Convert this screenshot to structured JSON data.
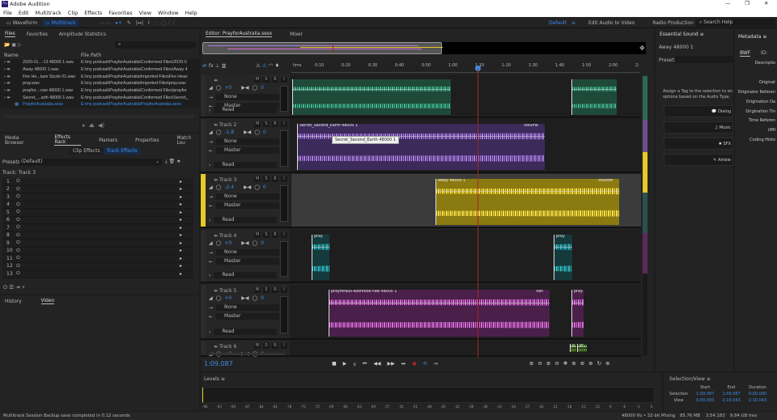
{
  "app": {
    "title": "Adobe Audition",
    "logo": "Au"
  },
  "menu": [
    "File",
    "Edit",
    "Multitrack",
    "Clip",
    "Effects",
    "Favorites",
    "View",
    "Window",
    "Help"
  ],
  "toolbar": {
    "waveform": "Waveform",
    "multitrack": "Multitrack",
    "workspaces": [
      "Default",
      "Edit Audio to Video",
      "Radio Production"
    ],
    "search_placeholder": "Search Help"
  },
  "files": {
    "tabs": [
      "Files",
      "Favorites",
      "Amplitude Statistics"
    ],
    "columns": [
      "Name",
      "File Path"
    ],
    "search_placeholder": "",
    "rows": [
      {
        "name": "2020-01...-13 48000 1.wav",
        "path": "E:\\my podcast\\PrayforAustralia\\Conformed Files\\2020-0"
      },
      {
        "name": "Away 48000 1.wav",
        "path": "E:\\my podcast\\PrayforAustralia\\Conformed Files\\Away 4"
      },
      {
        "name": "Fire He...laze Sizzle 01.wav",
        "path": "E:\\my podcast\\PrayforAustralia\\Imported Files\\Fire Heav"
      },
      {
        "name": "pray.wav",
        "path": "E:\\my podcast\\PrayforAustralia\\Imported Files\\pray.wav"
      },
      {
        "name": "prayfor...-raw 48000 1.wav",
        "path": "E:\\my podcast\\PrayforAustralia\\Conformed Files\\prayfor"
      },
      {
        "name": "Secret_...arth 48000 1.wav",
        "path": "E:\\my podcast\\PrayforAustralia\\Conformed Files\\Secret_"
      },
      {
        "name": "PrayforAustralia.sesx",
        "path": "E:\\my podcast\\PrayforAustralia\\PrayforAustralia.sesx",
        "active": true
      }
    ]
  },
  "effects": {
    "tabs": [
      "Media Browser",
      "Effects Rack",
      "Markers",
      "Properties",
      "Match Lou"
    ],
    "subtabs": [
      "Clip Effects",
      "Track Effects"
    ],
    "presets_label": "Presets:",
    "preset": "(Default)",
    "track_label": "Track: Track 3",
    "slots": [
      "1",
      "2",
      "3",
      "4",
      "5",
      "6",
      "7",
      "8",
      "9",
      "10",
      "11",
      "12",
      "13"
    ]
  },
  "bottom_tabs": [
    "History",
    "Video"
  ],
  "editor": {
    "tabs": [
      "Editor: PrayforAustralia.sesx",
      "Mixer"
    ],
    "ruler": [
      "hms",
      "0:10",
      "0:20",
      "0:30",
      "0:40",
      "0:50",
      "1:00",
      "1:10",
      "1:20",
      "1:30",
      "1:40",
      "1:50",
      "2:00",
      "2:"
    ],
    "time": "1:09.087",
    "tracks": [
      {
        "name": "",
        "vol": "+0",
        "pan": "0",
        "input": "None",
        "output": "Master",
        "mode": "Read",
        "color": "#3fb58d"
      },
      {
        "name": "Track 2",
        "vol": "-1.8",
        "pan": "0",
        "input": "None",
        "output": "Master",
        "mode": "Read",
        "color": "#a77be0"
      },
      {
        "name": "Track 3",
        "vol": "-2.4",
        "pan": "0",
        "input": "None",
        "output": "Master",
        "mode": "Read",
        "color": "#e7c928"
      },
      {
        "name": "Track 4",
        "vol": "+0",
        "pan": "0",
        "input": "None",
        "output": "Master",
        "mode": "Read",
        "color": "#2fbcc4"
      },
      {
        "name": "Track 5",
        "vol": "+0",
        "pan": "0",
        "input": "None",
        "output": "Master",
        "mode": "Read",
        "color": "#d86bd8"
      },
      {
        "name": "Track 6",
        "vol": "+0",
        "pan": "0",
        "input": "",
        "output": "",
        "mode": "",
        "color": "#8bc34a"
      }
    ],
    "clips": {
      "secret": "Secret_Second_Earth 48000 1",
      "secret_fx": "Volume",
      "tooltip": "Secret_Second_Earth 48000 1",
      "away": "Away 48000 1",
      "away_fx": "Volume",
      "pray": "pray",
      "pray_trunc": "pray...",
      "prayforaus": "prayforaus-koonfook-raw 48000 1",
      "prayforaus_fx": "Pan",
      "t6a": "p...",
      "t6b": "pr..."
    },
    "track_buttons": [
      "M",
      "S",
      "R",
      "I"
    ]
  },
  "essential": {
    "title": "Essential Sound",
    "clip": "Away 48000 1",
    "preset_label": "Preset:",
    "hint": "Assign a Tag to the selection to en options based on the Audio Type.",
    "types": [
      "Dialog",
      "Music",
      "SFX",
      "Ambie"
    ]
  },
  "metadata": {
    "title": "Metadata",
    "tabs": [
      "BWF",
      "ID:"
    ],
    "fields": [
      "Descriptio",
      "Originat",
      "Originator Referen",
      "Origination Da",
      "Origination Tin",
      "Time Referen",
      "UMI",
      "Coding Histo"
    ]
  },
  "levels": {
    "title": "Levels",
    "scale": [
      "-96",
      "-93",
      "-90",
      "-87",
      "-84",
      "-81",
      "-78",
      "-75",
      "-72",
      "-69",
      "-66",
      "-63",
      "-60",
      "-57",
      "-54",
      "-51",
      "-48",
      "-45",
      "-42",
      "-39",
      "-36",
      "-33",
      "-30",
      "-27",
      "-24",
      "-21",
      "-18",
      "-15",
      "-12",
      "-9",
      "-6",
      "-3",
      "0"
    ]
  },
  "selection": {
    "title": "Selection/View",
    "cols": [
      "Start",
      "End",
      "Duration"
    ],
    "selection_label": "Selection",
    "view_label": "View",
    "selection": [
      "1:09.087",
      "1:09.087",
      "0:00.000"
    ],
    "view": [
      "0:00.000",
      "2:10.043",
      "2:10.043"
    ]
  },
  "status": {
    "message": "Multitrack Session Backup save completed in 0.12 seconds",
    "format": "48000 Hz • 32-bit Mixing",
    "mem": "85.76 MB",
    "duration": "3:54.183",
    "free": "9.84 GB free"
  }
}
